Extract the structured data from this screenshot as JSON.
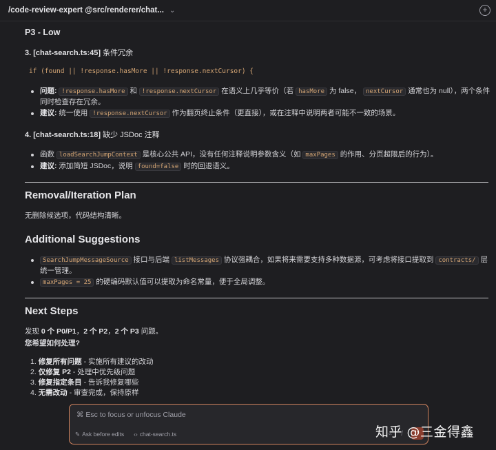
{
  "titlebar": {
    "title": "/code-review-expert @src/renderer/chat...",
    "chevron": "⌄",
    "new_icon": "+"
  },
  "p3": {
    "heading": "P3 - Low",
    "issue3": {
      "title": "3. [chat-search.ts:45]",
      "title_tail": "条件冗余",
      "code": "if (found || !response.hasMore || !response.nextCursor) {",
      "problem_label": "问题:",
      "problem_code1": "!response.hasMore",
      "problem_and": "和",
      "problem_code2": "!response.nextCursor",
      "problem_text1": "在语义上几乎等价（若",
      "problem_code3": "hasMore",
      "problem_text2": "为 false，",
      "problem_code4": "nextCursor",
      "problem_text3": "通常也为 null），两个条件同时检查存在冗余。",
      "suggest_label": "建议:",
      "suggest_text1": "统一使用",
      "suggest_code": "!response.nextCursor",
      "suggest_text2": "作为翻页终止条件（更直接），或在注释中说明两者可能不一致的场景。"
    },
    "issue4": {
      "title": "4. [chat-search.ts:18]",
      "title_tail": "缺少 JSDoc 注释",
      "b1_text1": "函数",
      "b1_code1": "loadSearchJumpContext",
      "b1_text2": "是核心公共 API，没有任何注释说明参数含义（如",
      "b1_code2": "maxPages",
      "b1_text3": "的作用、分页超限后的行为）。",
      "b2_label": "建议:",
      "b2_text1": "添加简短 JSDoc，说明",
      "b2_code": "found=false",
      "b2_text2": "时的回退语义。"
    }
  },
  "removal": {
    "heading": "Removal/Iteration Plan",
    "text": "无删除候选项，代码结构清晰。"
  },
  "additional": {
    "heading": "Additional Suggestions",
    "b1_code1": "SearchJumpMessageSource",
    "b1_text1": "接口与后端",
    "b1_code2": "listMessages",
    "b1_text2": "协议强耦合，如果将来需要支持多种数据源，可考虑将接口提取到",
    "b1_code3": "contracts/",
    "b1_text3": "层统一管理。",
    "b2_code": "maxPages = 25",
    "b2_text": "的硬编码默认值可以提取为命名常量，便于全局调整。"
  },
  "next": {
    "heading": "Next Steps",
    "summary_pre": "发现",
    "summary_b1": "0 个 P0/P1",
    "summary_mid1": "，",
    "summary_b2": "2 个 P2",
    "summary_mid2": "，",
    "summary_b3": "2 个 P3",
    "summary_post": "问题。",
    "question": "您希望如何处理?",
    "steps": [
      {
        "num": "1.",
        "bold": "修复所有问题",
        "rest": " - 实施所有建议的改动"
      },
      {
        "num": "2.",
        "bold": "仅修复 P2",
        "rest": " - 处理中优先级问题"
      },
      {
        "num": "3.",
        "bold": "修复指定条目",
        "rest": " - 告诉我修复哪些"
      },
      {
        "num": "4.",
        "bold": "无需改动",
        "rest": " - 审查完成，保持原样"
      }
    ]
  },
  "input": {
    "placeholder": "⌘ Esc to focus or unfocus Claude",
    "mode": "Ask before edits",
    "file": "chat-search.ts",
    "mode_icon": "pencil-icon",
    "file_icon": "code-icon"
  },
  "watermark": "知乎 @三金得鑫",
  "colors": {
    "background": "#1e1e21",
    "accent": "#d4855f",
    "code": "#d4a574"
  }
}
